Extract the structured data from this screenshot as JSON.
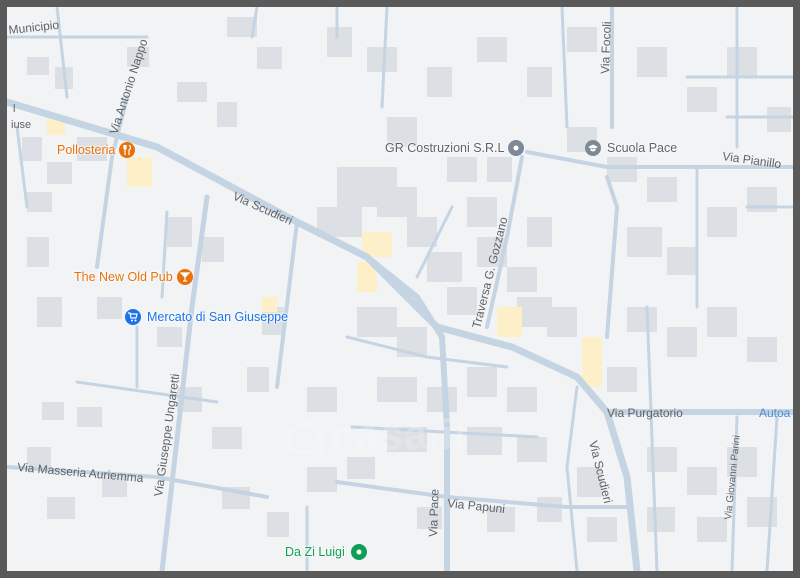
{
  "map": {
    "streets": [
      {
        "id": "via-scudieri-1",
        "label": "Via Scudieri"
      },
      {
        "id": "via-scudieri-2",
        "label": "Via Scudieri"
      },
      {
        "id": "via-antonio-nappo",
        "label": "Via Antonio Nappo"
      },
      {
        "id": "via-giuseppe-ungaretti",
        "label": "Via Giuseppe Ungaretti"
      },
      {
        "id": "via-masseria-auriemma",
        "label": "Via Masseria Auriemma"
      },
      {
        "id": "via-pace",
        "label": "Via Pace"
      },
      {
        "id": "via-papuni",
        "label": "Via Papuni"
      },
      {
        "id": "traversa-gozzano",
        "label": "Traversa G. Gozzano"
      },
      {
        "id": "via-purgatorio",
        "label": "Via Purgatorio"
      },
      {
        "id": "via-focoli",
        "label": "Via Focoli"
      },
      {
        "id": "via-pianillo",
        "label": "Via Pianillo"
      },
      {
        "id": "via-giovanni-parini",
        "label": "Via Giovanni Parini"
      },
      {
        "id": "municipio",
        "label": "Municipio"
      },
      {
        "id": "autoa",
        "label": "Autoa"
      },
      {
        "id": "giuse",
        "label": "iuse"
      },
      {
        "id": "l",
        "label": "l"
      }
    ],
    "pois": [
      {
        "id": "pollosteria",
        "label": "Pollosteria",
        "icon": "restaurant-icon",
        "color": "#e8710a"
      },
      {
        "id": "the-new-old-pub",
        "label": "The New Old Pub",
        "icon": "bar-icon",
        "color": "#e8710a"
      },
      {
        "id": "mercato",
        "label": "Mercato di San Giuseppe",
        "icon": "shopping-cart-icon",
        "color": "#1a73e8"
      },
      {
        "id": "gr-costruzioni",
        "label": "GR Costruzioni S.R.L",
        "icon": "location-icon",
        "color": "#7b8a96"
      },
      {
        "id": "scuola-pace",
        "label": "Scuola Pace",
        "icon": "school-icon",
        "color": "#7b8a96"
      },
      {
        "id": "da-zi-luigi",
        "label": "Da Zi Luigi",
        "icon": "location-icon",
        "color": "#0f9d58"
      }
    ],
    "watermark": "casa.it",
    "colors": {
      "background": "#f2f3f5",
      "road": "#b9cadb",
      "road_minor": "#cdd9e5",
      "building": "#dcdfe3",
      "building_highlight": "#fdf0c8",
      "poi_orange": "#e8710a",
      "poi_blue": "#1a73e8",
      "poi_gray": "#7b8a96",
      "poi_green": "#0f9d58"
    }
  }
}
